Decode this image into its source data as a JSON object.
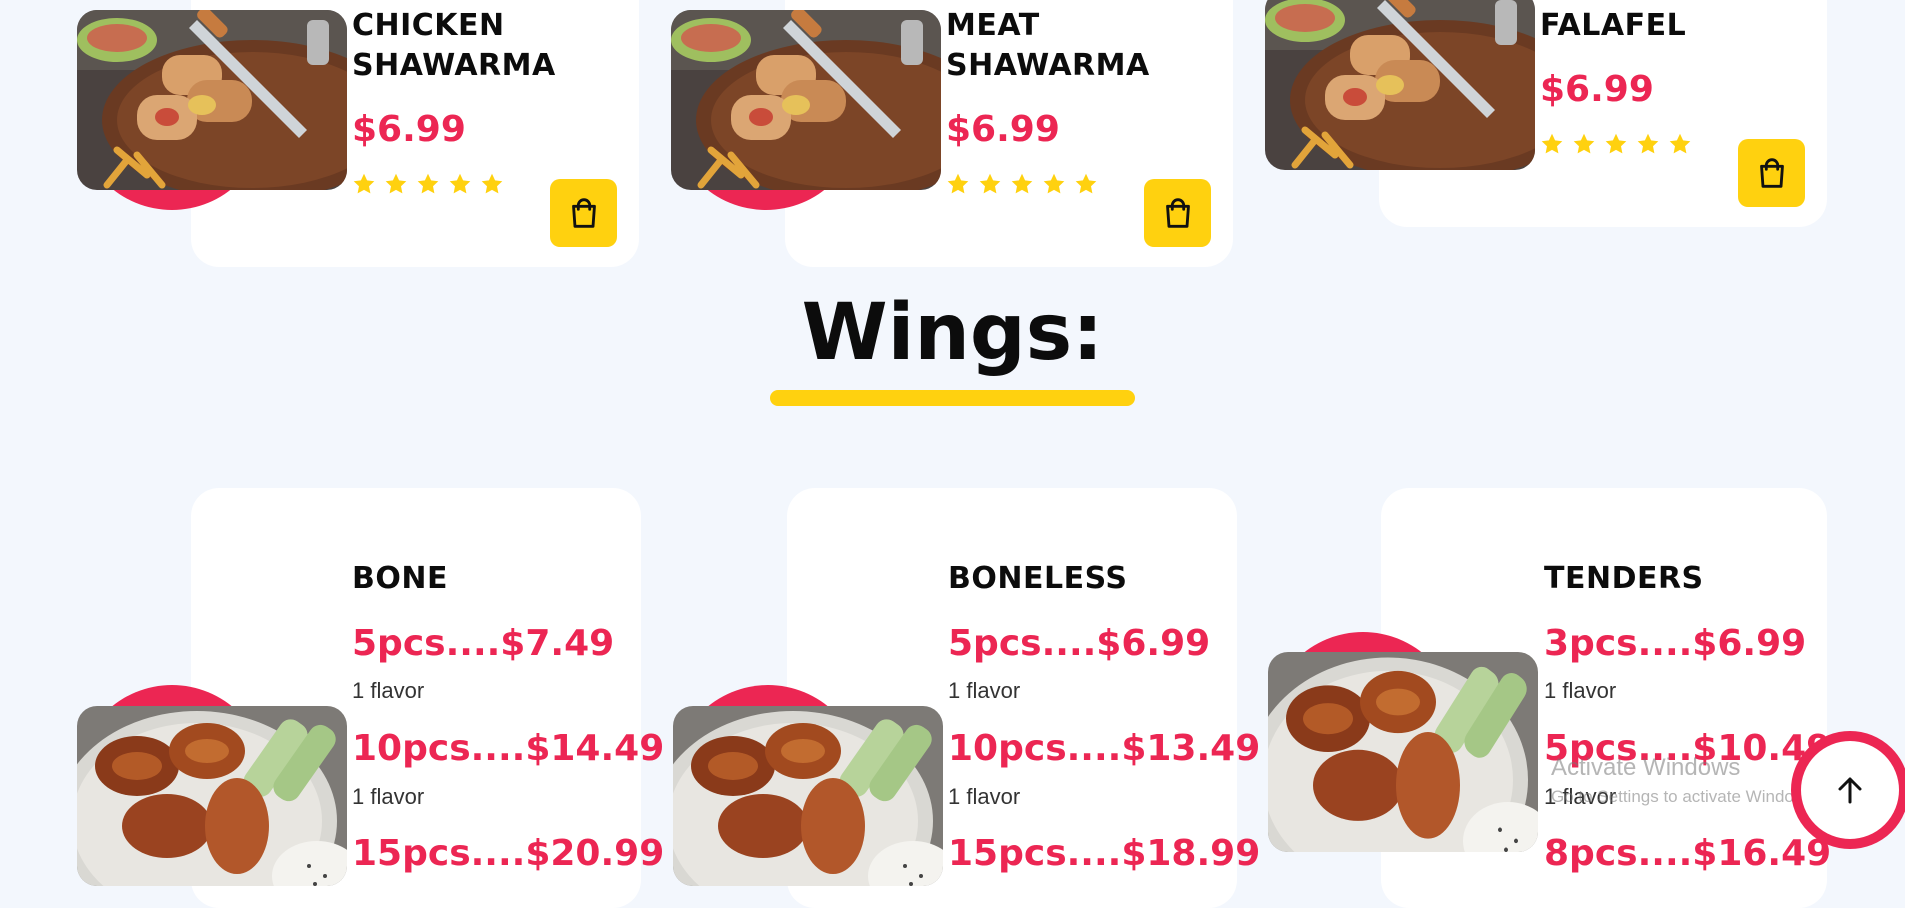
{
  "shawarma_items": [
    {
      "name": "CHICKEN SHAWARMA",
      "price": "$6.99",
      "rating": 5
    },
    {
      "name": "MEAT SHAWARMA",
      "price": "$6.99",
      "rating": 5
    },
    {
      "name": "FALAFEL",
      "price": "$6.99",
      "rating": 5
    }
  ],
  "wings_section": {
    "title": "Wings:",
    "items": [
      {
        "name": "BONE",
        "options": [
          {
            "price": "5pcs....$7.49",
            "note": "1 flavor"
          },
          {
            "price": "10pcs....$14.49",
            "note": "1 flavor"
          },
          {
            "price": "15pcs....$20.99"
          }
        ]
      },
      {
        "name": "BONELESS",
        "options": [
          {
            "price": "5pcs....$6.99",
            "note": "1 flavor"
          },
          {
            "price": "10pcs....$13.49",
            "note": "1 flavor"
          },
          {
            "price": "15pcs....$18.99"
          }
        ]
      },
      {
        "name": "TENDERS",
        "options": [
          {
            "price": "3pcs....$6.99",
            "note": "1 flavor"
          },
          {
            "price": "5pcs....$10.49",
            "note": "1 flavor"
          },
          {
            "price": "8pcs....$16.49"
          }
        ]
      }
    ]
  },
  "watermark": {
    "title": "Activate Windows",
    "subtitle": "Go to Settings to activate Windows."
  },
  "icons": {
    "cart": "shopping-bag-icon",
    "rating": "star-icon",
    "scroll_top": "arrow-up-icon"
  },
  "colors": {
    "accent_red": "#ec2653",
    "accent_yellow": "#ffd10f",
    "background": "#f3f7fd",
    "card": "#ffffff"
  }
}
